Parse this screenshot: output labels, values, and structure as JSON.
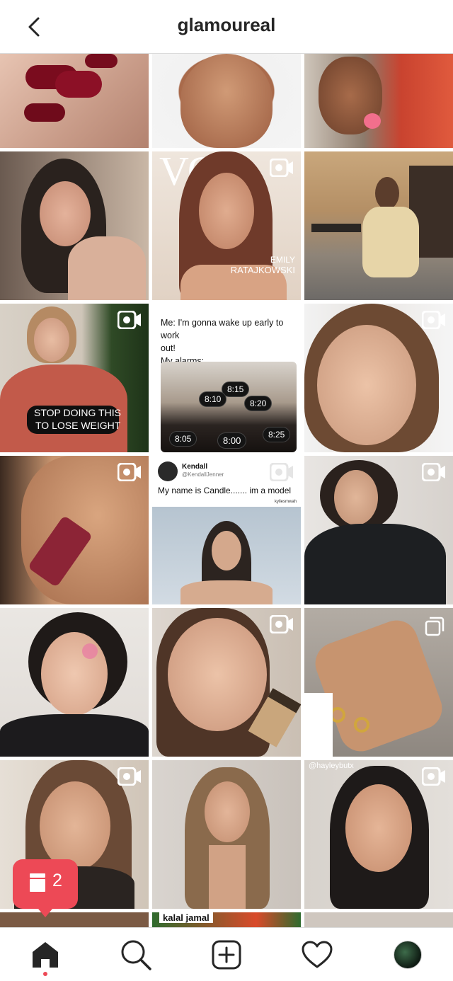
{
  "header": {
    "title": "glamoureal"
  },
  "grid": {
    "tile_7": {
      "lines": [
        "Me: I'm gonna wake up early to work",
        "out!",
        "My alarms:"
      ],
      "alarms": [
        "8:15",
        "8:10",
        "8:20",
        "8:05",
        "8:00",
        "8:25"
      ]
    },
    "tile_6_caption": [
      "STOP DOING THIS",
      "TO LOSE WEIGHT"
    ],
    "tile_4_overlay": {
      "brand": "VO",
      "name_line1": "EMILY",
      "name_line2": "RATAJKOWSKI"
    },
    "tile_10": {
      "name": "Kendall",
      "handle": "@KendallJenner",
      "text": "My name is Candle....... im a model",
      "credit": "kyliesmwah"
    },
    "tile_17_tag": "@hayleybutx",
    "tile_19_label": "kalal jamal"
  },
  "notification": {
    "count": "2"
  },
  "bottom_nav": [
    "home",
    "search",
    "create",
    "activity",
    "profile"
  ],
  "colors": {
    "accent": "#ed4956",
    "border": "#dbdbdb",
    "text": "#262626"
  }
}
